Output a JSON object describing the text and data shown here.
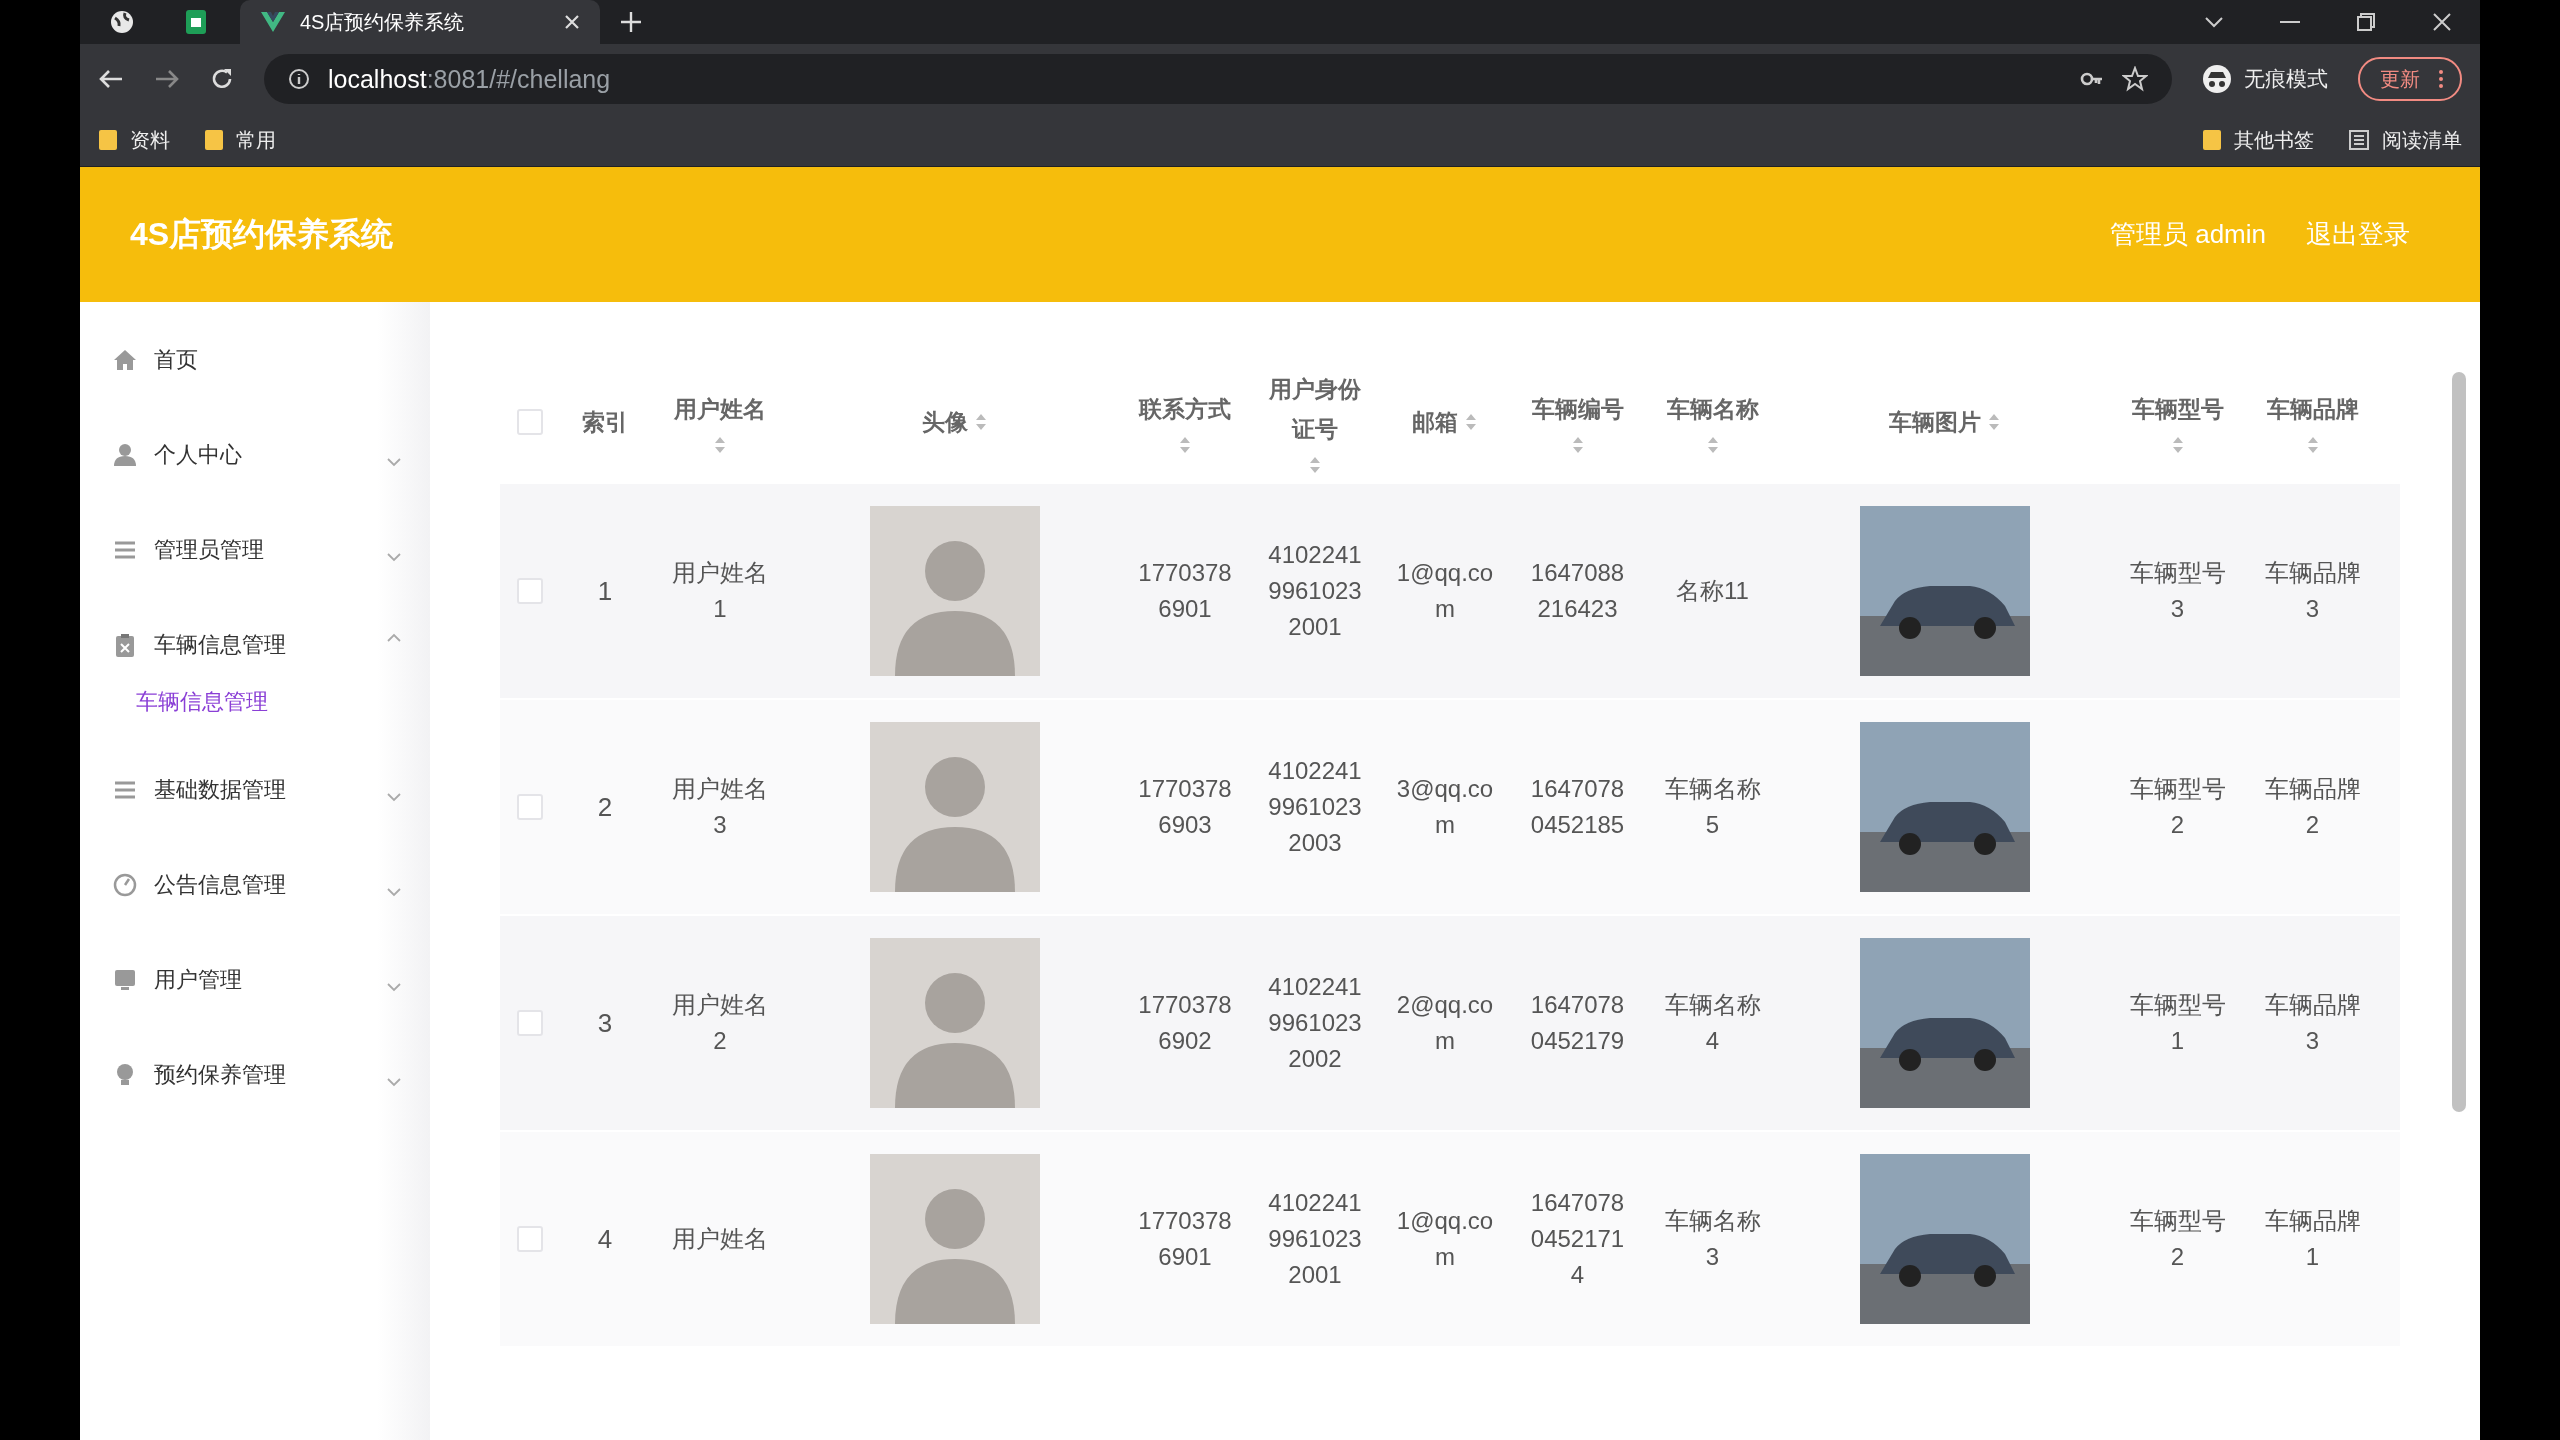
{
  "browser": {
    "tabs": [
      {
        "title": "4S店预约保养系统",
        "selected": true
      }
    ],
    "address": {
      "host": "localhost",
      "rest": ":8081/#/chellang"
    },
    "profile": {
      "label": "无痕模式"
    },
    "update_button": "更新",
    "bookmarks": {
      "left": [
        "资料",
        "常用"
      ],
      "right": [
        {
          "label": "其他书签",
          "kind": "folder"
        },
        {
          "label": "阅读清单",
          "kind": "reading-list"
        }
      ]
    }
  },
  "header": {
    "title": "4S店预约保养系统",
    "user": "管理员 admin",
    "logout": "退出登录"
  },
  "sidebar": {
    "items": [
      {
        "label": "首页",
        "kind": "link"
      },
      {
        "label": "个人中心",
        "kind": "submenu",
        "expanded": false
      },
      {
        "label": "管理员管理",
        "kind": "submenu",
        "expanded": false
      },
      {
        "label": "车辆信息管理",
        "kind": "submenu",
        "expanded": true,
        "children": [
          {
            "label": "车辆信息管理",
            "selected": true
          }
        ]
      },
      {
        "label": "基础数据管理",
        "kind": "submenu",
        "expanded": false
      },
      {
        "label": "公告信息管理",
        "kind": "submenu",
        "expanded": false
      },
      {
        "label": "用户管理",
        "kind": "submenu",
        "expanded": false
      },
      {
        "label": "预约保养管理",
        "kind": "submenu",
        "expanded": false
      }
    ]
  },
  "table": {
    "select_all": {
      "checked": false
    },
    "columns": [
      {
        "label": "索引",
        "kind": "text",
        "sortable": false
      },
      {
        "label": "用户姓名",
        "kind": "text",
        "sortable": true
      },
      {
        "label": "头像",
        "kind": "avatar",
        "sortable": true
      },
      {
        "label": "联系方式",
        "kind": "text",
        "sortable": true
      },
      {
        "label": "用户身份证号",
        "kind": "text",
        "sortable": true
      },
      {
        "label": "邮箱",
        "kind": "text",
        "sortable": true
      },
      {
        "label": "车辆编号",
        "kind": "text",
        "sortable": true
      },
      {
        "label": "车辆名称",
        "kind": "text",
        "sortable": true
      },
      {
        "label": "车辆图片",
        "kind": "car-photo",
        "sortable": true
      },
      {
        "label": "车辆型号",
        "kind": "text",
        "sortable": true
      },
      {
        "label": "车辆品牌",
        "kind": "text",
        "sortable": true
      }
    ],
    "rows": [
      {
        "checked": false,
        "cells": [
          "1",
          "用户姓名1",
          "",
          "17703786901",
          "410224199610232001",
          "1@qq.com",
          "1647088216423",
          "名称11",
          "",
          "车辆型号3",
          "车辆品牌3"
        ]
      },
      {
        "checked": false,
        "cells": [
          "2",
          "用户姓名3",
          "",
          "17703786903",
          "410224199610232003",
          "3@qq.com",
          "16470780452185",
          "车辆名称5",
          "",
          "车辆型号2",
          "车辆品牌2"
        ]
      },
      {
        "checked": false,
        "cells": [
          "3",
          "用户姓名2",
          "",
          "17703786902",
          "410224199610232002",
          "2@qq.com",
          "16470780452179",
          "车辆名称4",
          "",
          "车辆型号1",
          "车辆品牌3"
        ]
      },
      {
        "checked": false,
        "cells": [
          "4",
          "用户姓名",
          "",
          "17703786901",
          "410224199610232001",
          "1@qq.com",
          "164707804521714",
          "车辆名称3",
          "",
          "车辆型号2",
          "车辆品牌1"
        ]
      }
    ]
  }
}
